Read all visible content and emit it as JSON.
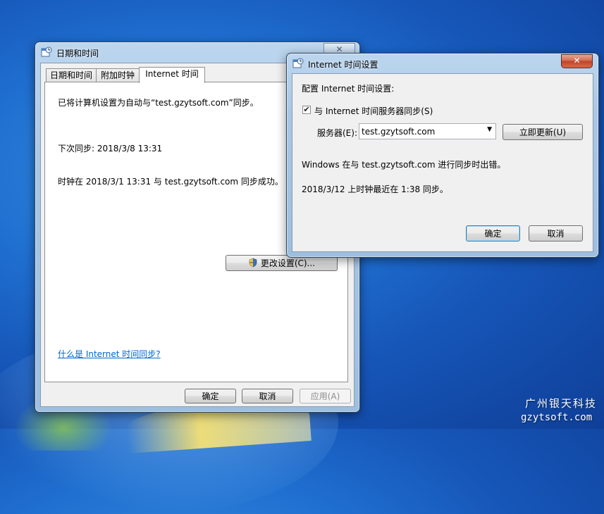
{
  "main_window": {
    "title": "日期和时间",
    "tabs": [
      {
        "label": "日期和时间"
      },
      {
        "label": "附加时钟"
      },
      {
        "label": "Internet 时间"
      }
    ],
    "panel": {
      "sync_message": "已将计算机设置为自动与“test.gzytsoft.com”同步。",
      "next_sync": "下次同步: 2018/3/8 13:31",
      "last_success": "时钟在 2018/3/1 13:31 与 test.gzytsoft.com 同步成功。",
      "change_settings_label": "更改设置(C)...",
      "help_link": "什么是 Internet 时间同步?"
    },
    "buttons": {
      "ok": "确定",
      "cancel": "取消",
      "apply": "应用(A)"
    }
  },
  "inet_dialog": {
    "title": "Internet 时间设置",
    "heading": "配置 Internet 时间设置:",
    "sync_checkbox_label": "与 Internet 时间服务器同步(S)",
    "sync_checked": true,
    "server_label": "服务器(E):",
    "server_value": "test.gzytsoft.com",
    "update_now": "立即更新(U)",
    "error_message": "Windows 在与 test.gzytsoft.com 进行同步时出错。",
    "last_sync_message": "2018/3/12 上时钟最近在 1:38 同步。",
    "ok": "确定",
    "cancel": "取消"
  },
  "watermark": {
    "company": "广州银天科技",
    "site": "gzytsoft.com"
  },
  "colors": {
    "link": "#0066cc",
    "close_button": "#c0432a",
    "desktop": "#1f6fd0"
  }
}
